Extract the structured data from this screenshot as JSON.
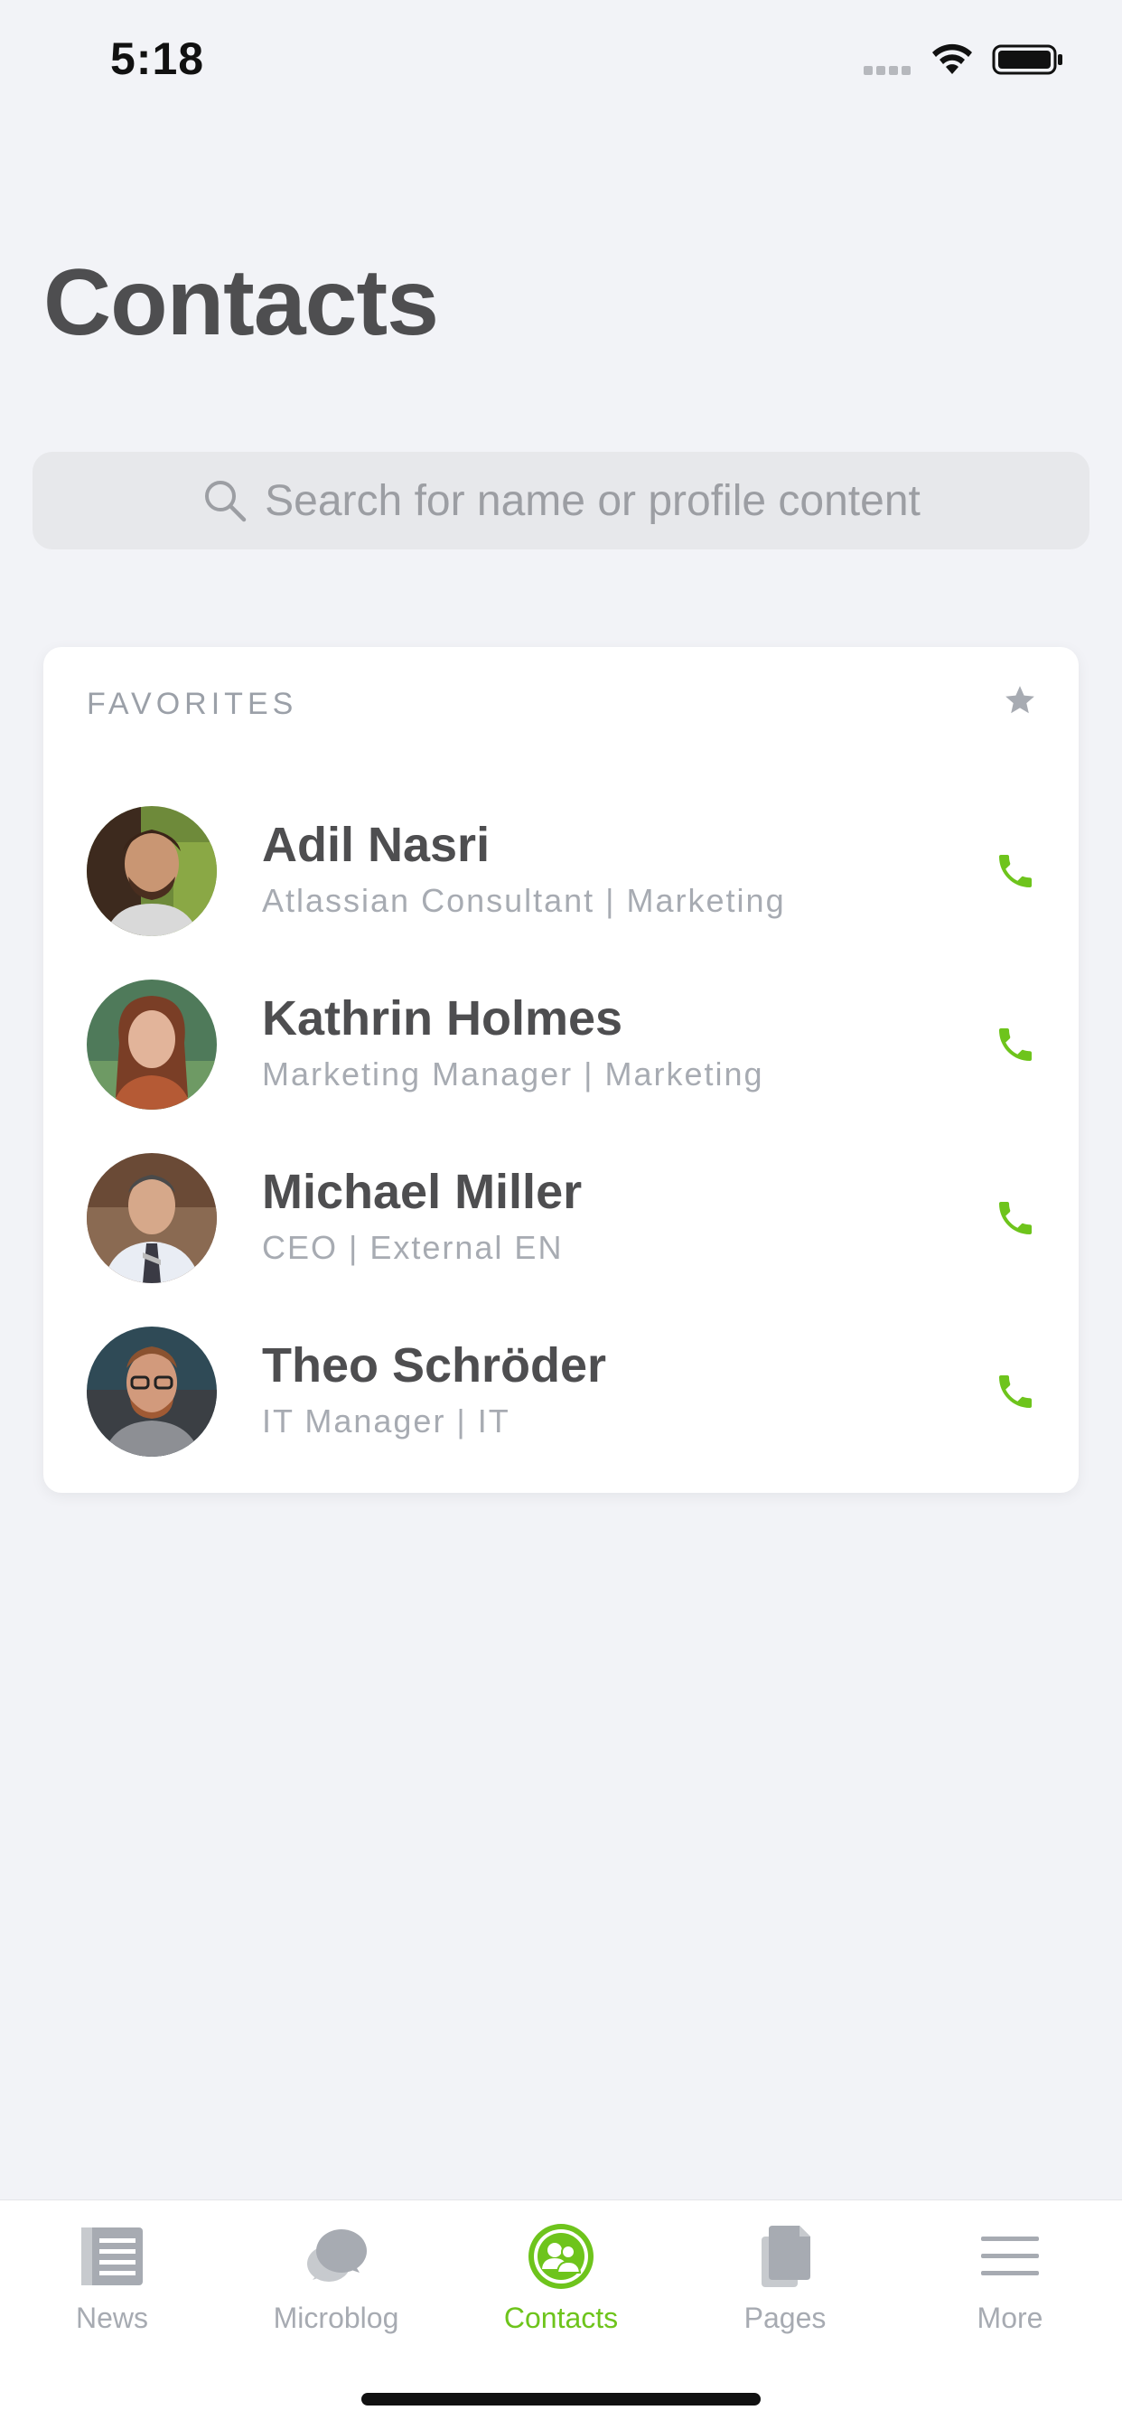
{
  "status_bar": {
    "time": "5:18"
  },
  "page": {
    "title": "Contacts"
  },
  "search": {
    "placeholder": "Search for name or profile content"
  },
  "favorites": {
    "heading": "FAVORITES",
    "contacts": [
      {
        "name": "Adil Nasri",
        "role": "Atlassian Consultant | Marketing"
      },
      {
        "name": "Kathrin Holmes",
        "role": "Marketing Manager | Marketing"
      },
      {
        "name": "Michael Miller",
        "role": "CEO | External EN"
      },
      {
        "name": "Theo Schröder",
        "role": "IT Manager | IT"
      }
    ]
  },
  "tabs": [
    {
      "label": "News",
      "icon": "news-icon",
      "active": false
    },
    {
      "label": "Microblog",
      "icon": "microblog-icon",
      "active": false
    },
    {
      "label": "Contacts",
      "icon": "contacts-icon",
      "active": true
    },
    {
      "label": "Pages",
      "icon": "pages-icon",
      "active": false
    },
    {
      "label": "More",
      "icon": "menu-icon",
      "active": false
    }
  ],
  "colors": {
    "accent": "#6ec41c",
    "background": "#f2f3f7",
    "title_text": "#4e4e50",
    "muted_text": "#a7abb2"
  }
}
